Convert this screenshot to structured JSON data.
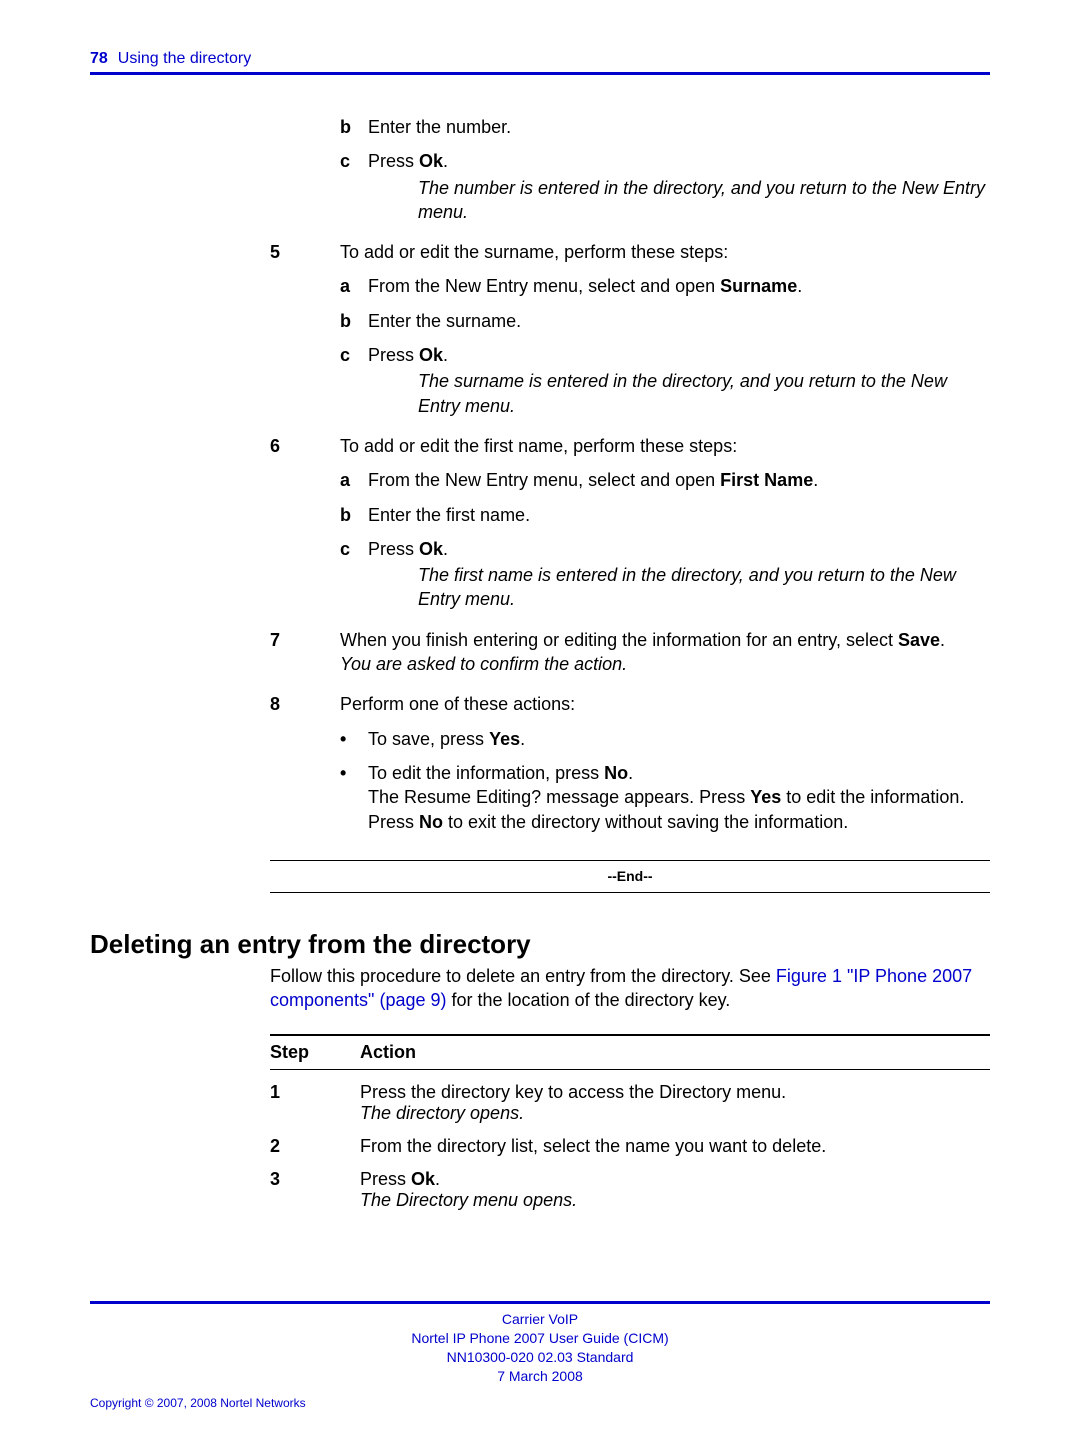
{
  "header": {
    "page_number": "78",
    "section": "Using the directory"
  },
  "body": {
    "cont_substeps_4": {
      "b": "Enter the number.",
      "c_label": "Press ",
      "c_bold": "Ok",
      "c_after": ".",
      "c_note": "The number is entered in the directory, and you return to the New Entry menu."
    },
    "step5": {
      "num": "5",
      "text": "To add or edit the surname, perform these steps:",
      "a_pre": "From the New Entry menu, select and open ",
      "a_bold": "Surname",
      "a_post": ".",
      "b": "Enter the surname.",
      "c_label": "Press ",
      "c_bold": "Ok",
      "c_after": ".",
      "c_note": "The surname is entered in the directory, and you return to the New Entry menu."
    },
    "step6": {
      "num": "6",
      "text": "To add or edit the first name, perform these steps:",
      "a_pre": "From the New Entry menu, select and open ",
      "a_bold": "First Name",
      "a_post": ".",
      "b": "Enter the first name.",
      "c_label": "Press ",
      "c_bold": "Ok",
      "c_after": ".",
      "c_note": "The first name is entered in the directory, and you return to the New Entry menu."
    },
    "step7": {
      "num": "7",
      "text_pre": "When you finish entering or editing the information for an entry, select ",
      "text_bold": "Save",
      "text_post": ".",
      "note": "You are asked to confirm the action."
    },
    "step8": {
      "num": "8",
      "text": "Perform one of these actions:",
      "bullet1_pre": "To save, press ",
      "bullet1_bold": "Yes",
      "bullet1_post": ".",
      "bullet2_pre": "To edit the information, press ",
      "bullet2_bold": "No",
      "bullet2_post": ".",
      "bullet2_line2a": "The Resume Editing? message appears. Press ",
      "bullet2_line2b": "Yes",
      "bullet2_line2c": " to edit the information. Press ",
      "bullet2_line2d": "No",
      "bullet2_line2e": " to exit the directory without saving the information."
    },
    "end_label": "--End--"
  },
  "section2": {
    "title": "Deleting an entry from the directory",
    "intro_a": "Follow this procedure to delete an entry from the directory. See ",
    "intro_link": "Figure 1 \"IP Phone 2007 components\" (page 9)",
    "intro_b": " for the location of the directory key.",
    "table": {
      "head_step": "Step",
      "head_action": "Action",
      "row1_num": "1",
      "row1_text": "Press the directory key to access the Directory menu.",
      "row1_note": "The directory opens.",
      "row2_num": "2",
      "row2_text": "From the directory list, select the name you want to delete.",
      "row3_num": "3",
      "row3_pre": "Press ",
      "row3_bold": "Ok",
      "row3_post": ".",
      "row3_note": "The Directory menu opens."
    }
  },
  "footer": {
    "line1": "Carrier VoIP",
    "line2": "Nortel IP Phone 2007 User Guide (CICM)",
    "line3": "NN10300-020   02.03   Standard",
    "line4": "7 March 2008",
    "copyright": "Copyright © 2007, 2008 Nortel Networks"
  }
}
